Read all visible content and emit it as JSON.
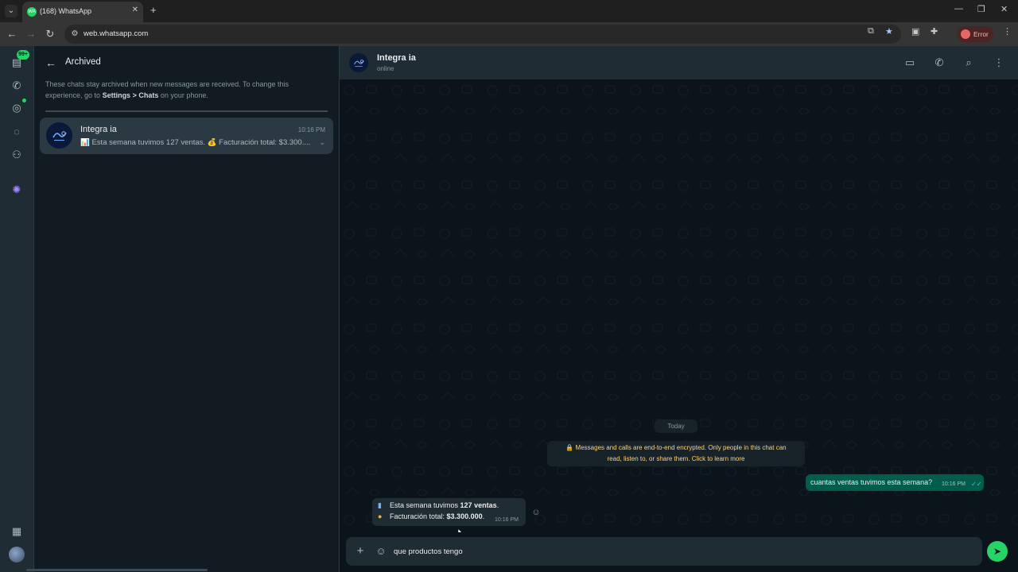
{
  "browser": {
    "tab_title": "(168) WhatsApp",
    "tab_favicon": "WA",
    "url": "web.whatsapp.com",
    "error_label": "Error"
  },
  "rail": {
    "chats_badge": "99+"
  },
  "archived": {
    "title": "Archived",
    "note_part1": "These chats stay archived when new messages are received. To change this experience, go to ",
    "note_bold": "Settings > Chats",
    "note_part2": " on your phone.",
    "chats": [
      {
        "name": "Integra ia",
        "time": "10:16 PM",
        "preview": "📊 Esta semana tuvimos 127 ventas. 💰 Facturación total: $3.300...."
      }
    ]
  },
  "chat": {
    "name": "Integra ia",
    "status": "online",
    "date_chip": "Today",
    "encryption_note_line1": "🔒 Messages and calls are end-to-end encrypted. Only people in this chat can",
    "encryption_note_line2": "read, listen to, or share them. Click to learn more",
    "outgoing": {
      "text": "cuantas ventas tuvimos esta semana?",
      "time": "10:16 PM"
    },
    "incoming": {
      "line1_prefix": "Esta semana tuvimos ",
      "line1_bold": "127 ventas",
      "line1_suffix": ".",
      "line2_prefix": "Facturación total: ",
      "line2_bold": "$3.300.000",
      "line2_suffix": ".",
      "time": "10:16 PM"
    },
    "composer_value": "que productos tengo"
  },
  "colors": {
    "accent": "#25d366",
    "outgoing_bubble": "#005c4b",
    "incoming_bubble": "#202c33",
    "panel_bg": "#111b21"
  },
  "icons": {
    "back": "arrow-left-icon",
    "video": "video-camera-icon",
    "call": "phone-icon",
    "search": "search-icon",
    "menu": "kebab-menu-icon",
    "send": "send-icon"
  }
}
